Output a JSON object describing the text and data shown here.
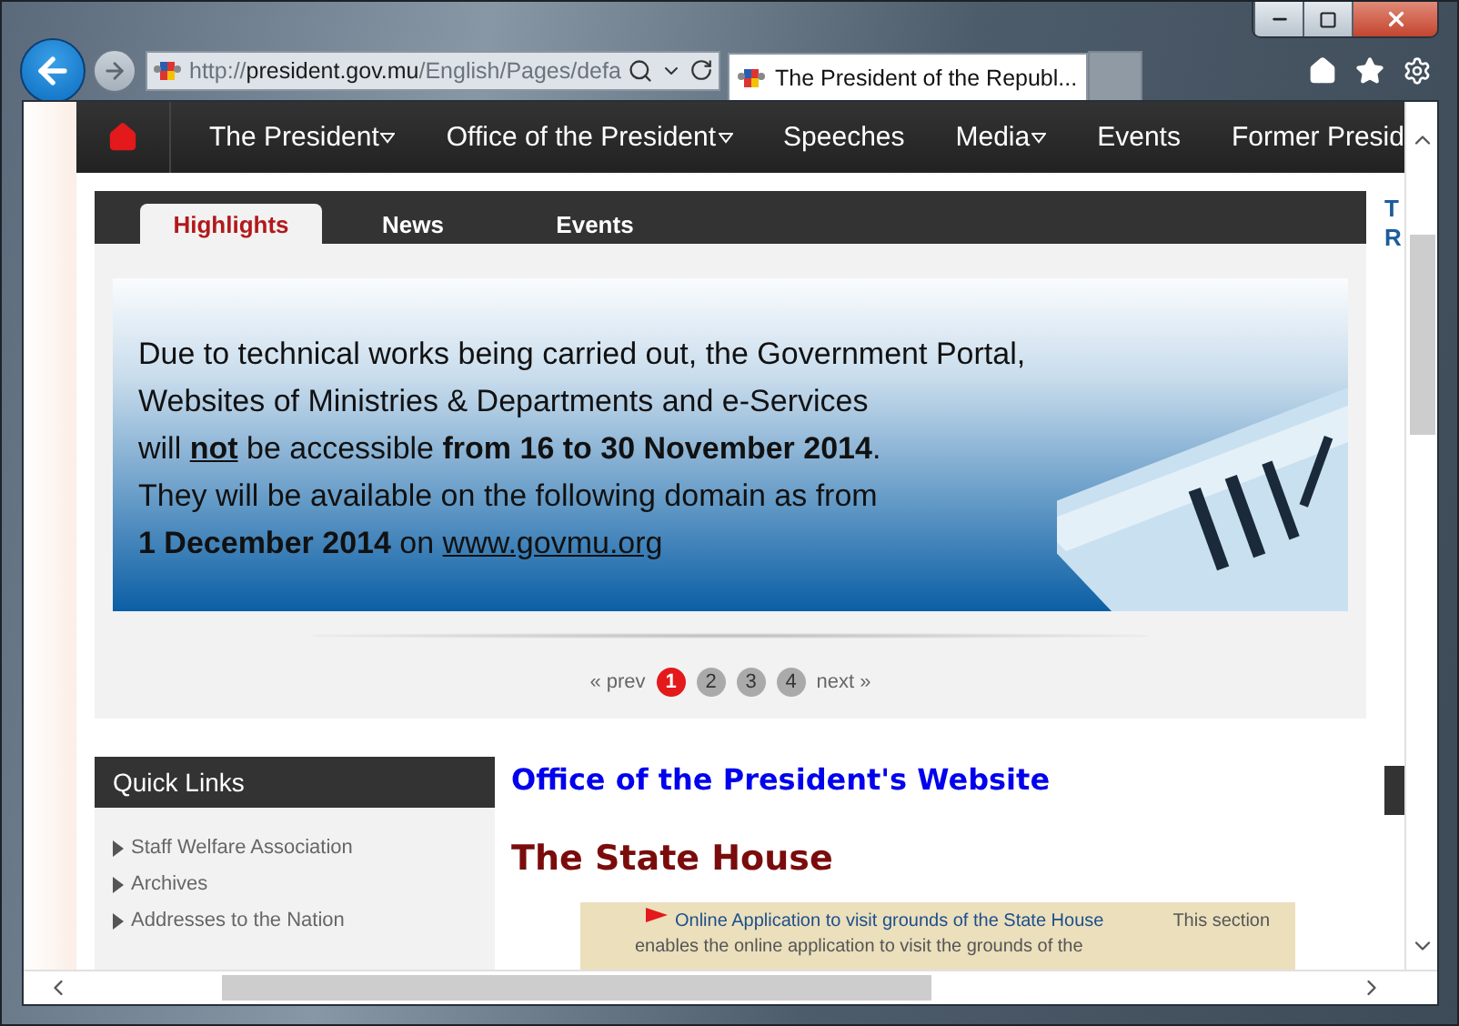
{
  "browser": {
    "address": {
      "scheme": "http://",
      "host": "president.gov.mu",
      "path": "/English/Pages/defa"
    },
    "tabs": [
      {
        "title": "The President of the Republ...",
        "selected": true
      }
    ]
  },
  "nav": {
    "items": [
      {
        "label": "The President",
        "dropdown": true
      },
      {
        "label": "Office of the President",
        "dropdown": true
      },
      {
        "label": "Speeches",
        "dropdown": false
      },
      {
        "label": "Media",
        "dropdown": true
      },
      {
        "label": "Events",
        "dropdown": false
      },
      {
        "label": "Former Presid",
        "dropdown": false
      }
    ]
  },
  "tabs": [
    {
      "label": "Highlights",
      "selected": true
    },
    {
      "label": "News",
      "selected": false
    },
    {
      "label": "Events",
      "selected": false
    }
  ],
  "banner": {
    "lines": [
      [
        {
          "text": "Due to technical works being carried out, the Government Portal,",
          "kind": "plain"
        }
      ],
      [
        {
          "text": "Websites of Ministries & Departments and e-Services",
          "kind": "plain"
        }
      ],
      [
        {
          "text": "will ",
          "kind": "plain"
        },
        {
          "text": "not",
          "kind": "emphasis"
        },
        {
          "text": " be accessible ",
          "kind": "plain"
        },
        {
          "text": "from 16 to 30 November 2014",
          "kind": "bold"
        },
        {
          "text": ".",
          "kind": "plain"
        }
      ],
      [
        {
          "text": "They will be available on the following domain as from",
          "kind": "plain"
        }
      ],
      [
        {
          "text": "1 December 2014",
          "kind": "bold"
        },
        {
          "text": " on ",
          "kind": "plain"
        },
        {
          "text": "www.govmu.org",
          "kind": "link"
        }
      ]
    ]
  },
  "pagination": {
    "prev": "« prev",
    "pages": [
      {
        "label": "1",
        "selected": true
      },
      {
        "label": "2",
        "selected": false
      },
      {
        "label": "3",
        "selected": false
      },
      {
        "label": "4",
        "selected": false
      }
    ],
    "next": "next »"
  },
  "side_column": {
    "texts": [
      "T",
      "R"
    ]
  },
  "quick_links": {
    "title": "Quick Links",
    "items": [
      "Staff Welfare Association",
      "Archives",
      "Addresses to the Nation"
    ]
  },
  "content": {
    "site_title": "Office of the President's Website",
    "heading": "The State House",
    "notice": {
      "link": "Online Application to visit grounds of the State House",
      "text": "This section enables the online application to visit the grounds of the"
    }
  }
}
